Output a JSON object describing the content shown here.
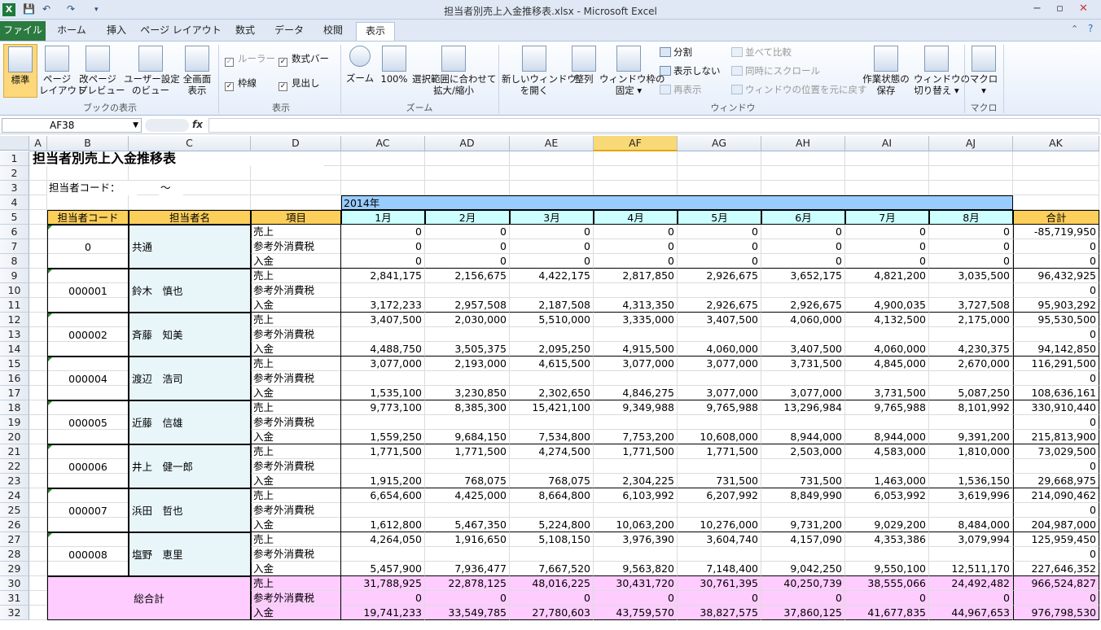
{
  "window": {
    "title": "担当者別売上入金推移表.xlsx - Microsoft Excel",
    "app_icon": "X"
  },
  "tabs": [
    "ファイル",
    "ホーム",
    "挿入",
    "ページ レイアウト",
    "数式",
    "データ",
    "校閲",
    "表示"
  ],
  "ribbon": {
    "views": {
      "normal": "標準",
      "page_layout": "ページ\nレイアウト",
      "page_break": "改ページ\nプレビュー",
      "custom": "ユーザー設定\nのビュー",
      "full": "全画面\n表示",
      "group": "ブックの表示"
    },
    "show": {
      "ruler": "ルーラー",
      "formula_bar": "数式バー",
      "gridlines": "枠線",
      "headings": "見出し",
      "group": "表示"
    },
    "zoom": {
      "zoom": "ズーム",
      "pct": "100%",
      "fit": "選択範囲に合わせて\n拡大/縮小",
      "group": "ズーム"
    },
    "window": {
      "new": "新しいウィンドウ\nを開く",
      "arrange": "整列",
      "freeze": "ウィンドウ枠の\n固定 ▾",
      "split": "分割",
      "hide": "表示しない",
      "unhide": "再表示",
      "side": "並べて比較",
      "sync": "同時にスクロール",
      "reset": "ウィンドウの位置を元に戻す",
      "save": "作業状態の\n保存",
      "switch": "ウィンドウの\n切り替え ▾",
      "group": "ウィンドウ"
    },
    "macro": {
      "macro": "マクロ\n▾",
      "group": "マクロ"
    }
  },
  "namebox": "AF38",
  "fx": "fx",
  "columns": [
    "A",
    "B",
    "C",
    "D",
    "AC",
    "AD",
    "AE",
    "AF",
    "AG",
    "AH",
    "AI",
    "AJ",
    "AK"
  ],
  "rows": [
    "1",
    "2",
    "3",
    "4",
    "5",
    "6",
    "7",
    "8",
    "9",
    "10",
    "11",
    "12",
    "13",
    "14",
    "15",
    "16",
    "17",
    "18",
    "19",
    "20",
    "21",
    "22",
    "23",
    "24",
    "25",
    "26",
    "27",
    "28",
    "29",
    "30",
    "31",
    "32"
  ],
  "sheet": {
    "title": "担当者別売上入金推移表",
    "code_label": "担当者コード：",
    "tilde": "～",
    "year": "2014年",
    "headers": {
      "code": "担当者コード",
      "name": "担当者名",
      "item": "項目",
      "months": [
        "1月",
        "2月",
        "3月",
        "4月",
        "5月",
        "6月",
        "7月",
        "8月"
      ],
      "total": "合計"
    },
    "item_labels": [
      "売上",
      "参考外消費税",
      "入金"
    ],
    "staff": [
      {
        "code": "0",
        "name": "共通",
        "rows": [
          [
            "0",
            "0",
            "0",
            "0",
            "0",
            "0",
            "0",
            "0",
            "-85,719,950"
          ],
          [
            "0",
            "0",
            "0",
            "0",
            "0",
            "0",
            "0",
            "0",
            "0"
          ],
          [
            "0",
            "0",
            "0",
            "0",
            "0",
            "0",
            "0",
            "0",
            "0"
          ]
        ]
      },
      {
        "code": "000001",
        "name": "鈴木　慎也",
        "rows": [
          [
            "2,841,175",
            "2,156,675",
            "4,422,175",
            "2,817,850",
            "2,926,675",
            "3,652,175",
            "4,821,200",
            "3,035,500",
            "96,432,925"
          ],
          [
            "",
            "",
            "",
            "",
            "",
            "",
            "",
            "",
            "0"
          ],
          [
            "3,172,233",
            "2,957,508",
            "2,187,508",
            "4,313,350",
            "2,926,675",
            "2,926,675",
            "4,900,035",
            "3,727,508",
            "95,903,292"
          ]
        ]
      },
      {
        "code": "000002",
        "name": "斉藤　知美",
        "rows": [
          [
            "3,407,500",
            "2,030,000",
            "5,510,000",
            "3,335,000",
            "3,407,500",
            "4,060,000",
            "4,132,500",
            "2,175,000",
            "95,530,500"
          ],
          [
            "",
            "",
            "",
            "",
            "",
            "",
            "",
            "",
            "0"
          ],
          [
            "4,488,750",
            "3,505,375",
            "2,095,250",
            "4,915,500",
            "4,060,000",
            "3,407,500",
            "4,060,000",
            "4,230,375",
            "94,142,850"
          ]
        ]
      },
      {
        "code": "000004",
        "name": "渡辺　浩司",
        "rows": [
          [
            "3,077,000",
            "2,193,000",
            "4,615,500",
            "3,077,000",
            "3,077,000",
            "3,731,500",
            "4,845,000",
            "2,670,000",
            "116,291,500"
          ],
          [
            "",
            "",
            "",
            "",
            "",
            "",
            "",
            "",
            "0"
          ],
          [
            "1,535,100",
            "3,230,850",
            "2,302,650",
            "4,846,275",
            "3,077,000",
            "3,077,000",
            "3,731,500",
            "5,087,250",
            "108,636,161"
          ]
        ]
      },
      {
        "code": "000005",
        "name": "近藤　信雄",
        "rows": [
          [
            "9,773,100",
            "8,385,300",
            "15,421,100",
            "9,349,988",
            "9,765,988",
            "13,296,984",
            "9,765,988",
            "8,101,992",
            "330,910,440"
          ],
          [
            "",
            "",
            "",
            "",
            "",
            "",
            "",
            "",
            "0"
          ],
          [
            "1,559,250",
            "9,684,150",
            "7,534,800",
            "7,753,200",
            "10,608,000",
            "8,944,000",
            "8,944,000",
            "9,391,200",
            "215,813,900"
          ]
        ]
      },
      {
        "code": "000006",
        "name": "井上　健一郎",
        "rows": [
          [
            "1,771,500",
            "1,771,500",
            "4,274,500",
            "1,771,500",
            "1,771,500",
            "2,503,000",
            "4,583,000",
            "1,810,000",
            "73,029,500"
          ],
          [
            "",
            "",
            "",
            "",
            "",
            "",
            "",
            "",
            "0"
          ],
          [
            "1,915,200",
            "768,075",
            "768,075",
            "2,304,225",
            "731,500",
            "731,500",
            "1,463,000",
            "1,536,150",
            "29,668,975"
          ]
        ]
      },
      {
        "code": "000007",
        "name": "浜田　哲也",
        "rows": [
          [
            "6,654,600",
            "4,425,000",
            "8,664,800",
            "6,103,992",
            "6,207,992",
            "8,849,990",
            "6,053,992",
            "3,619,996",
            "214,090,462"
          ],
          [
            "",
            "",
            "",
            "",
            "",
            "",
            "",
            "",
            "0"
          ],
          [
            "1,612,800",
            "5,467,350",
            "5,224,800",
            "10,063,200",
            "10,276,000",
            "9,731,200",
            "9,029,200",
            "8,484,000",
            "204,987,000"
          ]
        ]
      },
      {
        "code": "000008",
        "name": "塩野　恵里",
        "rows": [
          [
            "4,264,050",
            "1,916,650",
            "5,108,150",
            "3,976,390",
            "3,604,740",
            "4,157,090",
            "4,353,386",
            "3,079,994",
            "125,959,450"
          ],
          [
            "",
            "",
            "",
            "",
            "",
            "",
            "",
            "",
            "0"
          ],
          [
            "5,457,900",
            "7,936,477",
            "7,667,520",
            "9,563,820",
            "7,148,400",
            "9,042,250",
            "9,550,100",
            "12,511,170",
            "227,646,352"
          ]
        ]
      }
    ],
    "grand": {
      "label": "総合計",
      "rows": [
        [
          "31,788,925",
          "22,878,125",
          "48,016,225",
          "30,431,720",
          "30,761,395",
          "40,250,739",
          "38,555,066",
          "24,492,482",
          "966,524,827"
        ],
        [
          "0",
          "0",
          "0",
          "0",
          "0",
          "0",
          "0",
          "0",
          "0"
        ],
        [
          "19,741,233",
          "33,549,785",
          "27,780,603",
          "43,759,570",
          "38,827,575",
          "37,860,125",
          "41,677,835",
          "44,967,653",
          "976,798,530"
        ]
      ]
    }
  },
  "colors": {
    "header_orange": "#fccf5b",
    "month_cyan": "#ccffff",
    "year_blue": "#99ccff",
    "name_lightblue": "#e8f6fa",
    "grand_pink": "#ffccff"
  }
}
